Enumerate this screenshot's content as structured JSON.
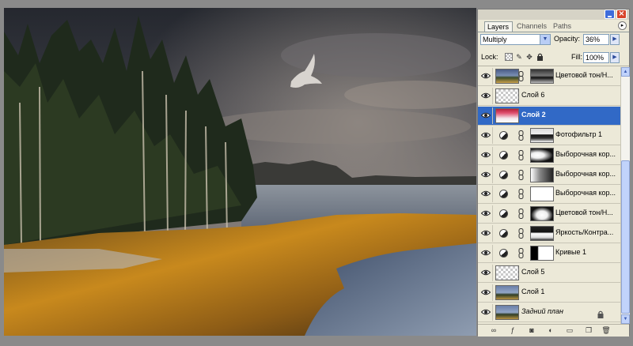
{
  "panel": {
    "tabs": [
      "Layers",
      "Channels",
      "Paths"
    ],
    "active_tab": "Layers",
    "blend_mode": "Multiply",
    "opacity_label": "Opacity:",
    "opacity_value": "36%",
    "lock_label": "Lock:",
    "fill_label": "Fill:",
    "fill_value": "100%"
  },
  "layers": [
    {
      "name": "Цветовой тон/Н...",
      "kind": "adjustment",
      "visible": true,
      "thumb": "photo",
      "mask": "m-photo"
    },
    {
      "name": "Слой 6",
      "kind": "pixel",
      "visible": true,
      "thumb": "transp"
    },
    {
      "name": "Слой 2",
      "kind": "pixel",
      "visible": true,
      "thumb": "red",
      "selected": true
    },
    {
      "name": "Фотофильтр 1",
      "kind": "adjustment",
      "visible": true,
      "mask": "m-trees"
    },
    {
      "name": "Выборочная кор...",
      "kind": "adjustment",
      "visible": true,
      "mask": "m-dark"
    },
    {
      "name": "Выборочная кор...",
      "kind": "adjustment",
      "visible": true,
      "mask": "m-gray"
    },
    {
      "name": "Выборочная кор...",
      "kind": "adjustment",
      "visible": true,
      "mask": "m-white"
    },
    {
      "name": "Цветовой тон/Н...",
      "kind": "adjustment",
      "visible": true,
      "mask": "m-black"
    },
    {
      "name": "Яркость/Контра...",
      "kind": "adjustment",
      "visible": true,
      "mask": "m-bright"
    },
    {
      "name": "Кривые 1",
      "kind": "adjustment",
      "visible": true,
      "mask": "m-curves"
    },
    {
      "name": "Слой 5",
      "kind": "pixel",
      "visible": true,
      "thumb": "transp"
    },
    {
      "name": "Слой 1",
      "kind": "pixel",
      "visible": true,
      "thumb": "photo2"
    },
    {
      "name": "Задний план",
      "kind": "background",
      "visible": true,
      "thumb": "photo2",
      "locked": true
    }
  ],
  "bottom_icons": [
    "link-layers-icon",
    "layer-style-icon",
    "layer-mask-icon",
    "adjustment-layer-icon",
    "new-group-icon",
    "new-layer-icon",
    "trash-icon"
  ],
  "colors": {
    "selection": "#3169c6",
    "panel_bg": "#ece9d8",
    "canvas_bg": "#8a8a8a"
  }
}
